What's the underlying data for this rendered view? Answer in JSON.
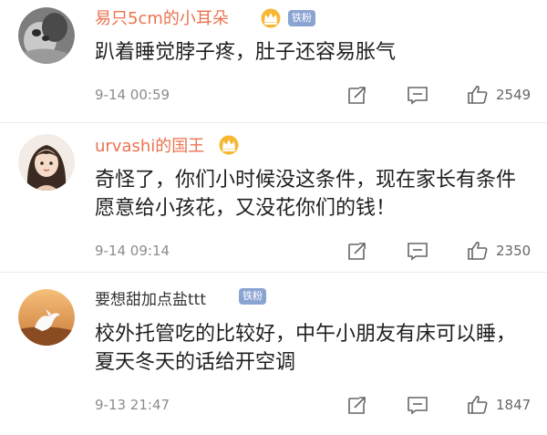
{
  "comments": [
    {
      "username": "易只5cm的小耳朵",
      "badge": "铁粉",
      "avatar_icon": "cat-avatar",
      "text": "趴着睡觉脖子疼，肚子还容易胀气",
      "time": "9-14 00:59",
      "likes": "2549"
    },
    {
      "username": "urvashi的国王",
      "avatar_icon": "cartoon-girl-avatar",
      "text": "奇怪了，你们小时候没这条件，现在家长有条件愿意给小孩花，又没花你们的钱！",
      "time": "9-14 09:14",
      "likes": "2350"
    },
    {
      "username": "要想甜加点盐ttt",
      "badge": "铁粉",
      "avatar_icon": "sunset-bird-avatar",
      "text": "校外托管吃的比较好，中午小朋友有床可以睡，夏天冬天的话给开空调",
      "time": "9-13 21:47",
      "likes": "1847"
    }
  ],
  "colors": {
    "username": "#eb7350",
    "username_plain": "#333333",
    "badge_bg": "#8aa4d2",
    "crown": "#f0a020",
    "meta": "#8c8c8c"
  }
}
